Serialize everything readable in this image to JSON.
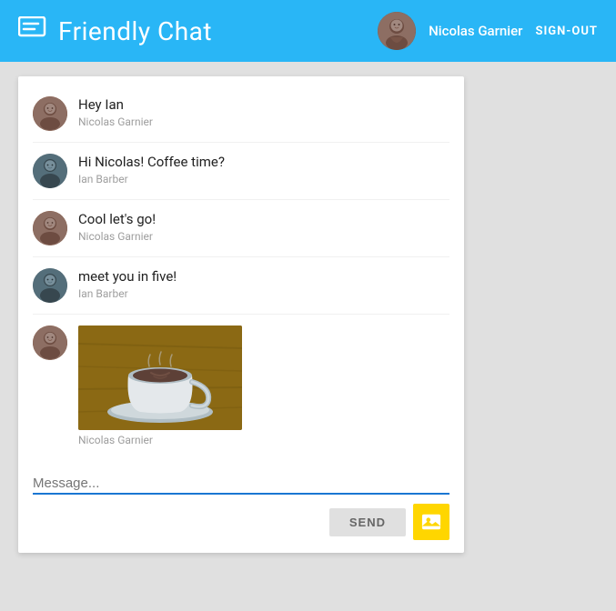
{
  "header": {
    "title": "Friendly Chat",
    "icon": "💬",
    "user": {
      "name": "Nicolas Garnier",
      "sign_out_label": "SIGN-OUT"
    }
  },
  "messages": [
    {
      "id": 1,
      "text": "Hey Ian",
      "author": "Nicolas Garnier",
      "avatar_type": "nicolas",
      "has_image": false
    },
    {
      "id": 2,
      "text": "Hi Nicolas! Coffee time?",
      "author": "Ian Barber",
      "avatar_type": "ian",
      "has_image": false
    },
    {
      "id": 3,
      "text": "Cool let's go!",
      "author": "Nicolas Garnier",
      "avatar_type": "nicolas",
      "has_image": false
    },
    {
      "id": 4,
      "text": "meet you in five!",
      "author": "Ian Barber",
      "avatar_type": "ian",
      "has_image": false
    },
    {
      "id": 5,
      "text": "",
      "author": "Nicolas Garnier",
      "avatar_type": "nicolas",
      "has_image": true
    }
  ],
  "input": {
    "placeholder": "Message...",
    "value": "",
    "send_label": "SEND"
  }
}
